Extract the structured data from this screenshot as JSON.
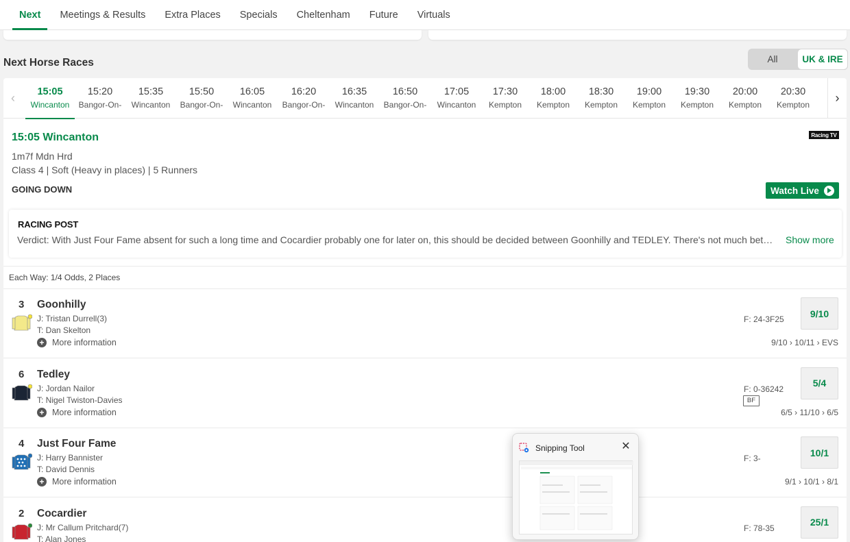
{
  "nav": {
    "tabs": [
      "Next",
      "Meetings & Results",
      "Extra Places",
      "Specials",
      "Cheltenham",
      "Future",
      "Virtuals"
    ],
    "active": "Next"
  },
  "section": {
    "title": "Next Horse Races",
    "toggle": {
      "all": "All",
      "uk": "UK & IRE"
    }
  },
  "times": [
    {
      "time": "15:05",
      "course": "Wincanton"
    },
    {
      "time": "15:20",
      "course": "Bangor-On-"
    },
    {
      "time": "15:35",
      "course": "Wincanton"
    },
    {
      "time": "15:50",
      "course": "Bangor-On-"
    },
    {
      "time": "16:05",
      "course": "Wincanton"
    },
    {
      "time": "16:20",
      "course": "Bangor-On-"
    },
    {
      "time": "16:35",
      "course": "Wincanton"
    },
    {
      "time": "16:50",
      "course": "Bangor-On-"
    },
    {
      "time": "17:05",
      "course": "Wincanton"
    },
    {
      "time": "17:30",
      "course": "Kempton"
    },
    {
      "time": "18:00",
      "course": "Kempton"
    },
    {
      "time": "18:30",
      "course": "Kempton"
    },
    {
      "time": "19:00",
      "course": "Kempton"
    },
    {
      "time": "19:30",
      "course": "Kempton"
    },
    {
      "time": "20:00",
      "course": "Kempton"
    },
    {
      "time": "20:30",
      "course": "Kempton"
    }
  ],
  "race": {
    "title": "15:05 Wincanton",
    "tv": "Racing TV",
    "distance": "1m7f Mdn Hrd",
    "info": "Class 4 | Soft (Heavy in places) | 5 Runners",
    "status": "GOING DOWN",
    "watch_live": "Watch Live"
  },
  "verdict": {
    "logo": "RACING POST",
    "text": "Verdict: With Just Four Fame absent for such a long time and Cocardier probably one for later on, this should be decided between Goonhilly and TEDLEY. There's not much between them on ratings but Tedley was the one preferred.",
    "show_more": "Show more"
  },
  "each_way": "Each Way: 1/4 Odds, 2 Places",
  "more_info_label": "More information",
  "runners": [
    {
      "num": "3",
      "name": "Goonhilly",
      "jockey": "J: Tristan Durrell(3)",
      "trainer": "T: Dan Skelton",
      "form": "F: 24-3F25",
      "bf": "",
      "odds": "9/10",
      "history": "9/10 › 10/11 › EVS",
      "silk": "yellow"
    },
    {
      "num": "6",
      "name": "Tedley",
      "jockey": "J: Jordan Nailor",
      "trainer": "T: Nigel Twiston-Davies",
      "form": "F: 0-36242",
      "bf": "BF",
      "odds": "5/4",
      "history": "6/5 › 11/10 › 6/5",
      "silk": "navy"
    },
    {
      "num": "4",
      "name": "Just Four Fame",
      "jockey": "J: Harry Bannister",
      "trainer": "T: David Dennis",
      "form": "F: 3-",
      "bf": "",
      "odds": "10/1",
      "history": "9/1 › 10/1 › 8/1",
      "silk": "blue-spots"
    },
    {
      "num": "2",
      "name": "Cocardier",
      "jockey": "J: Mr Callum Pritchard(7)",
      "trainer": "T: Alan Jones",
      "form": "F: 78-35",
      "bf": "",
      "odds": "25/1",
      "history": "",
      "silk": "red"
    }
  ],
  "snipping_tool": {
    "title": "Snipping Tool"
  },
  "colors": {
    "brand": "#088a4b"
  }
}
